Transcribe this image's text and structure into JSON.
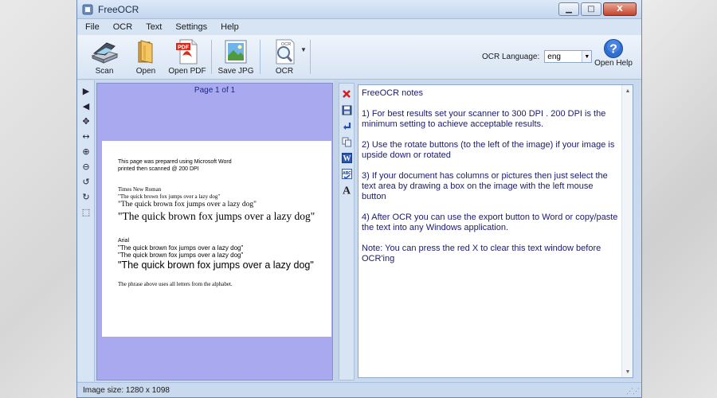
{
  "window": {
    "title": "FreeOCR",
    "controls": {
      "minimize": "▁",
      "maximize": "□",
      "close": "X"
    }
  },
  "menu": [
    "File",
    "OCR",
    "Text",
    "Settings",
    "Help"
  ],
  "toolbar": {
    "buttons": [
      {
        "label": "Scan",
        "icon": "scanner-icon"
      },
      {
        "label": "Open",
        "icon": "folder-icon"
      },
      {
        "label": "Open PDF",
        "icon": "pdf-icon"
      },
      {
        "label": "Save JPG",
        "icon": "image-icon"
      },
      {
        "label": "OCR",
        "icon": "ocr-magnifier-icon"
      }
    ],
    "pdf_badge": "PDF",
    "ocr_badge": "OCR",
    "ocr_language_label": "OCR Language:",
    "ocr_language_value": "eng",
    "open_help_label": "Open Help",
    "help_glyph": "?"
  },
  "left_tools": [
    {
      "glyph": "▶",
      "name": "next-page-icon"
    },
    {
      "glyph": "◀",
      "name": "previous-page-icon"
    },
    {
      "glyph": "✥",
      "name": "pan-icon"
    },
    {
      "glyph": "↔",
      "name": "fit-width-icon"
    },
    {
      "glyph": "⊕",
      "name": "zoom-in-icon"
    },
    {
      "glyph": "⊖",
      "name": "zoom-out-icon"
    },
    {
      "glyph": "↺",
      "name": "rotate-left-icon"
    },
    {
      "glyph": "↻",
      "name": "rotate-right-icon"
    },
    {
      "glyph": "⬚",
      "name": "select-area-icon"
    }
  ],
  "image_pane": {
    "page_indicator": "Page 1 of 1",
    "document_lines": [
      "This page was prepared using Microsoft Word",
      "printed then scanned @ 200 DPI",
      "Times New Roman",
      "\"The quick brown fox jumps over a lazy dog\"",
      "\"The quick brown fox jumps over a lazy dog\"",
      "\"The quick brown fox jumps over a lazy dog\"",
      "Arial",
      "\"The quick brown fox jumps over a lazy dog\"",
      "\"The quick brown fox  jumps over a lazy dog\"",
      "\"The quick brown fox jumps over a lazy dog\"",
      "The phrase above uses all letters from the alphabet."
    ]
  },
  "colors": {
    "image_background": "#a9a9ef",
    "text_color": "#1a1a6e",
    "clear_red": "#d42020"
  },
  "text_pane": {
    "paragraphs": [
      "FreeOCR notes",
      "1) For best results set your scanner to 300 DPI . 200 DPI is the minimum setting to achieve acceptable results.",
      "2) Use the rotate buttons (to the left of the image) if your image is upside down or rotated",
      "3) If your document has columns or pictures then just select the text area by drawing a box on the image with the left mouse button",
      "4) After OCR you can use the export button to Word or copy/paste the text into any Windows application.",
      "Note: You can press the red X to clear this text window before OCR'ing"
    ]
  },
  "status": {
    "image_size": "Image size:  1280 x 1098"
  }
}
